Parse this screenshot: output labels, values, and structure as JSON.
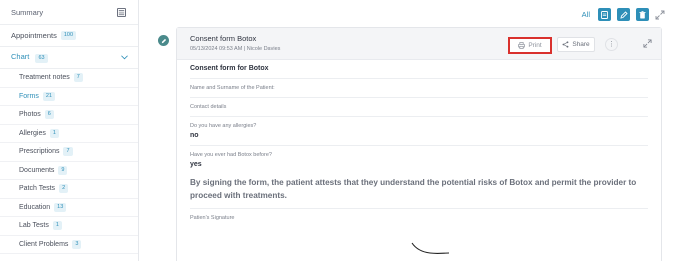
{
  "sidebar": {
    "summary": "Summary",
    "appointments": {
      "label": "Appointments",
      "count": "100"
    },
    "chart": {
      "label": "Chart",
      "count": "63"
    },
    "items": [
      {
        "label": "Treatment notes",
        "count": "7"
      },
      {
        "label": "Forms",
        "count": "21"
      },
      {
        "label": "Photos",
        "count": "6"
      },
      {
        "label": "Allergies",
        "count": "1"
      },
      {
        "label": "Prescriptions",
        "count": "7"
      },
      {
        "label": "Documents",
        "count": "9"
      },
      {
        "label": "Patch Tests",
        "count": "2"
      },
      {
        "label": "Education",
        "count": "13"
      },
      {
        "label": "Lab Tests",
        "count": "1"
      },
      {
        "label": "Client Problems",
        "count": "3"
      }
    ]
  },
  "topbar": {
    "all_label": "All"
  },
  "card": {
    "title": "Consent form Botox",
    "meta": "05/13/2024 09:53 AM | Nicole Davies",
    "print_label": "Print",
    "share_label": "Share",
    "more_label": "⋮"
  },
  "form": {
    "name": "Consent form for Botox",
    "field_name": "Name and Surname of the Patient:",
    "field_contact": "Contact details",
    "q1": "Do you have any allergies?",
    "a1": "no",
    "q2": "Have you ever had Botox before?",
    "a2": "yes",
    "statement": "By signing the form, the patient attests that they understand the potential risks of Botox and permit the provider to proceed with treatments.",
    "signature_label": "Patien's Signature"
  },
  "colors": {
    "accent": "#2e8fb8",
    "timeline": "#4a8a8b",
    "highlight": "#d9312d"
  }
}
